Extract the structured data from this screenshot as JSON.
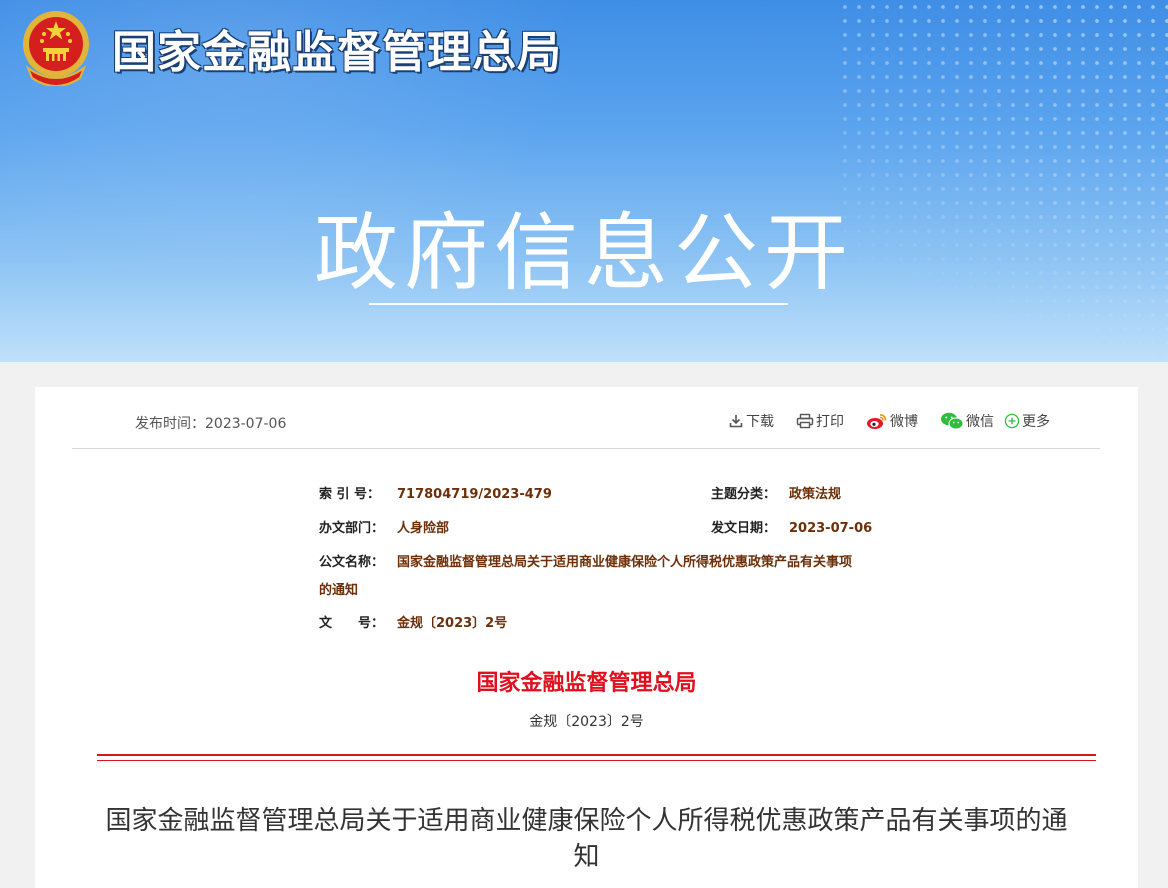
{
  "header": {
    "org_name": "国家金融监督管理总局",
    "section_title": "政府信息公开"
  },
  "toolbar": {
    "publish_label": "发布时间：",
    "publish_date": "2023-07-06",
    "download": "下载",
    "print": "打印",
    "weibo": "微博",
    "wechat": "微信",
    "more": "更多"
  },
  "meta": {
    "index_label": "索 引 号：",
    "index_value": "717804719/2023-479",
    "topic_label": "主题分类：",
    "topic_value": "政策法规",
    "dept_label": "办文部门：",
    "dept_value": "人身险部",
    "date_label": "发文日期：",
    "date_value": "2023-07-06",
    "name_label": "公文名称：",
    "name_value_line1": "国家金融监督管理总局关于适用商业健康保险个人所得税优惠政策产品有关事项",
    "name_value_line2": "的通知",
    "docno_label": "文　　号：",
    "docno_value": "金规〔2023〕2号"
  },
  "document": {
    "issuer": "国家金融监督管理总局",
    "number": "金规〔2023〕2号",
    "title_line1": "国家金融监督管理总局关于适用商业健康保险个人所得税优惠政策产品有关事项的通",
    "title_line2": "知"
  },
  "colors": {
    "banner_top": "#3f8ee6",
    "banner_bottom": "#bfe0fb",
    "issuer_red": "#e0101e",
    "meta_value": "#6b2f0a"
  }
}
